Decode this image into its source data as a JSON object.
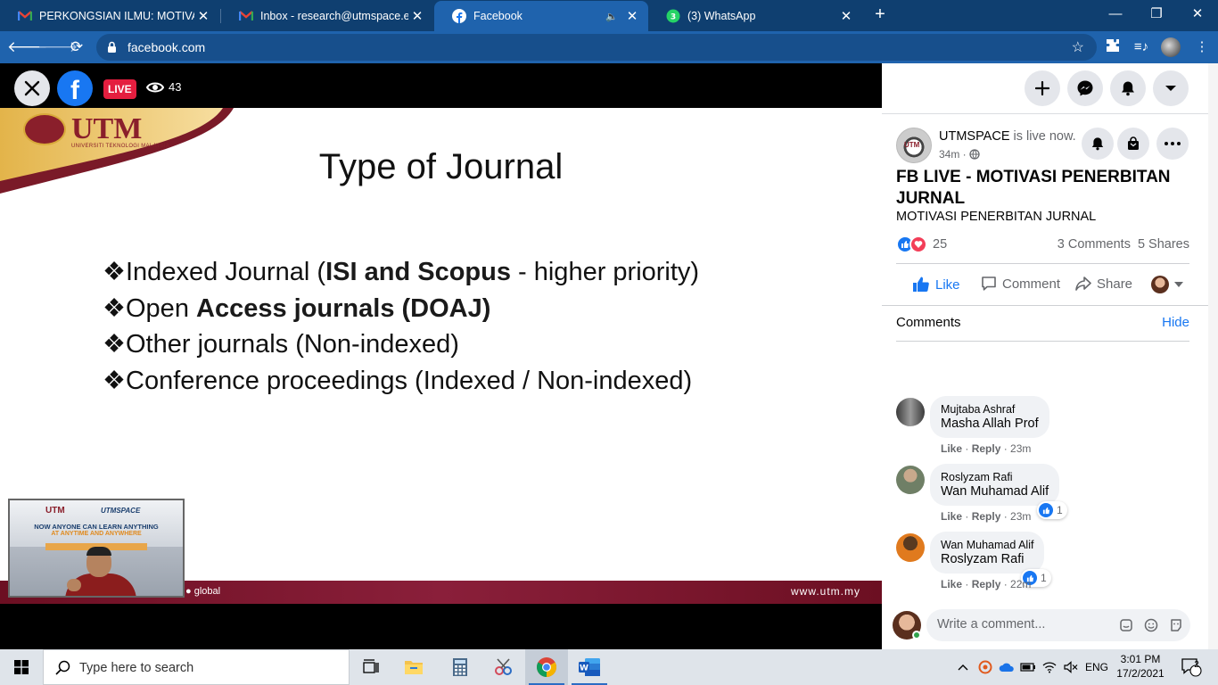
{
  "browser": {
    "tabs": [
      {
        "title": "PERKONGSIAN ILMU: MOTIVASI PENERBITAN",
        "icon": "gmail-icon",
        "active": false
      },
      {
        "title": "Inbox - research@utmspace.edu.my",
        "icon": "gmail-icon",
        "active": false
      },
      {
        "title": "Facebook",
        "icon": "facebook-icon",
        "active": true
      },
      {
        "title": "(3) WhatsApp",
        "icon": "whatsapp-icon",
        "active": false
      }
    ],
    "url": "facebook.com"
  },
  "video": {
    "live_label": "LIVE",
    "viewer_count": "43"
  },
  "slide": {
    "logo_word": "UTM",
    "logo_sub": "UNIVERSITI TEKNOLOGI MALAYSIA",
    "title": "Type of Journal",
    "bullet_symbol": "❖",
    "bullets": [
      {
        "pre": "Indexed Journal (",
        "bold": "ISI and Scopus",
        "post": " - higher priority)"
      },
      {
        "pre": "Open ",
        "bold": "Access journals (DOAJ)",
        "post": ""
      },
      {
        "pre": "Other journals (Non-indexed)",
        "bold": "",
        "post": ""
      },
      {
        "pre": "Conference proceedings (Indexed / Non-indexed)",
        "bold": "",
        "post": ""
      }
    ],
    "footer_left": "● global",
    "footer_right": "www.utm.my"
  },
  "pip": {
    "line1": "UTM",
    "line2": "UTMSPACE",
    "line3": "NOW ANYONE CAN LEARN ANYTHING",
    "line4": "AT ANYTIME AND ANYWHERE"
  },
  "post": {
    "page_name": "UTMSPACE",
    "status": " is live now.",
    "time": "34m ·",
    "title": "FB LIVE - MOTIVASI PENERBITAN JURNAL",
    "description": "MOTIVASI PENERBITAN JURNAL",
    "reaction_count": "25",
    "comments_count": "3 Comments",
    "shares_count": "5 Shares",
    "actions": {
      "like": "Like",
      "comment": "Comment",
      "share": "Share"
    },
    "comments_header": "Comments",
    "hide_label": "Hide",
    "comments": [
      {
        "name": "Mujtaba Ashraf",
        "text": "Masha Allah Prof",
        "like": "Like",
        "reply": "Reply",
        "time": "23m",
        "likes": ""
      },
      {
        "name": "Roslyzam Rafi",
        "text": "Wan Muhamad Alif",
        "like": "Like",
        "reply": "Reply",
        "time": "23m",
        "likes": "1"
      },
      {
        "name": "Wan Muhamad Alif",
        "text": "Roslyzam Rafi",
        "like": "Like",
        "reply": "Reply",
        "time": "22m",
        "likes": "1"
      }
    ],
    "write_placeholder": "Write a comment..."
  },
  "taskbar": {
    "search_placeholder": "Type here to search",
    "language": "ENG",
    "time": "3:01 PM",
    "date": "17/2/2021",
    "notifications": "2"
  },
  "colors": {
    "chrome_tabstrip": "#0f3f70",
    "chrome_active": "#1f63ad",
    "facebook_blue": "#1877f2",
    "live_red": "#e41e3f",
    "utm_maroon": "#8a1f2b"
  }
}
